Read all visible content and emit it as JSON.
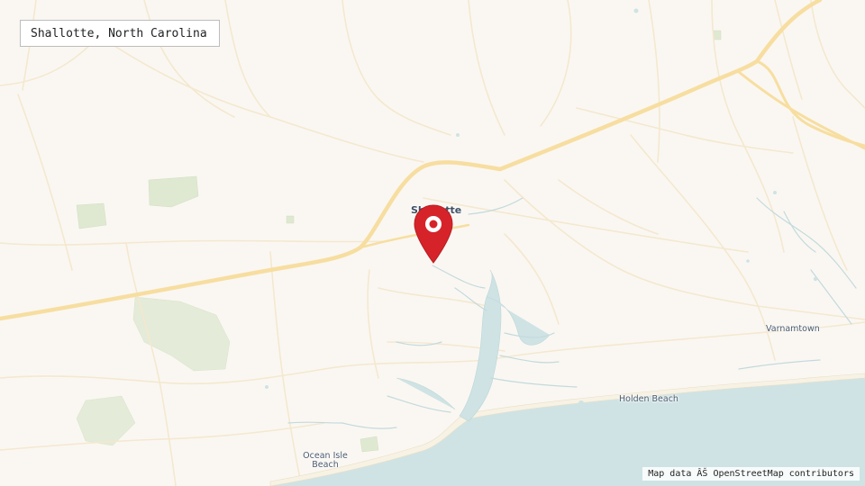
{
  "header": {
    "title": "Shallotte, North Carolina"
  },
  "map": {
    "places": [
      {
        "name": "Shallotte",
        "kind": "town"
      },
      {
        "name": "Varnamtown",
        "kind": "locality"
      },
      {
        "name": "Holden Beach",
        "kind": "locality"
      },
      {
        "name": "Ocean Isle Beach",
        "kind": "locality"
      }
    ],
    "marker": {
      "place": "Shallotte",
      "color": "#d6232a",
      "icon": "map-pin-icon"
    },
    "colors": {
      "land": "#faf7f2",
      "water": "#cfe3e4",
      "major_road": "#f7dea0",
      "minor_road": "#f4ead2",
      "park": "#dfe9d2"
    }
  },
  "attribution": {
    "text": "Map data ÂŠ OpenStreetMap contributors"
  }
}
